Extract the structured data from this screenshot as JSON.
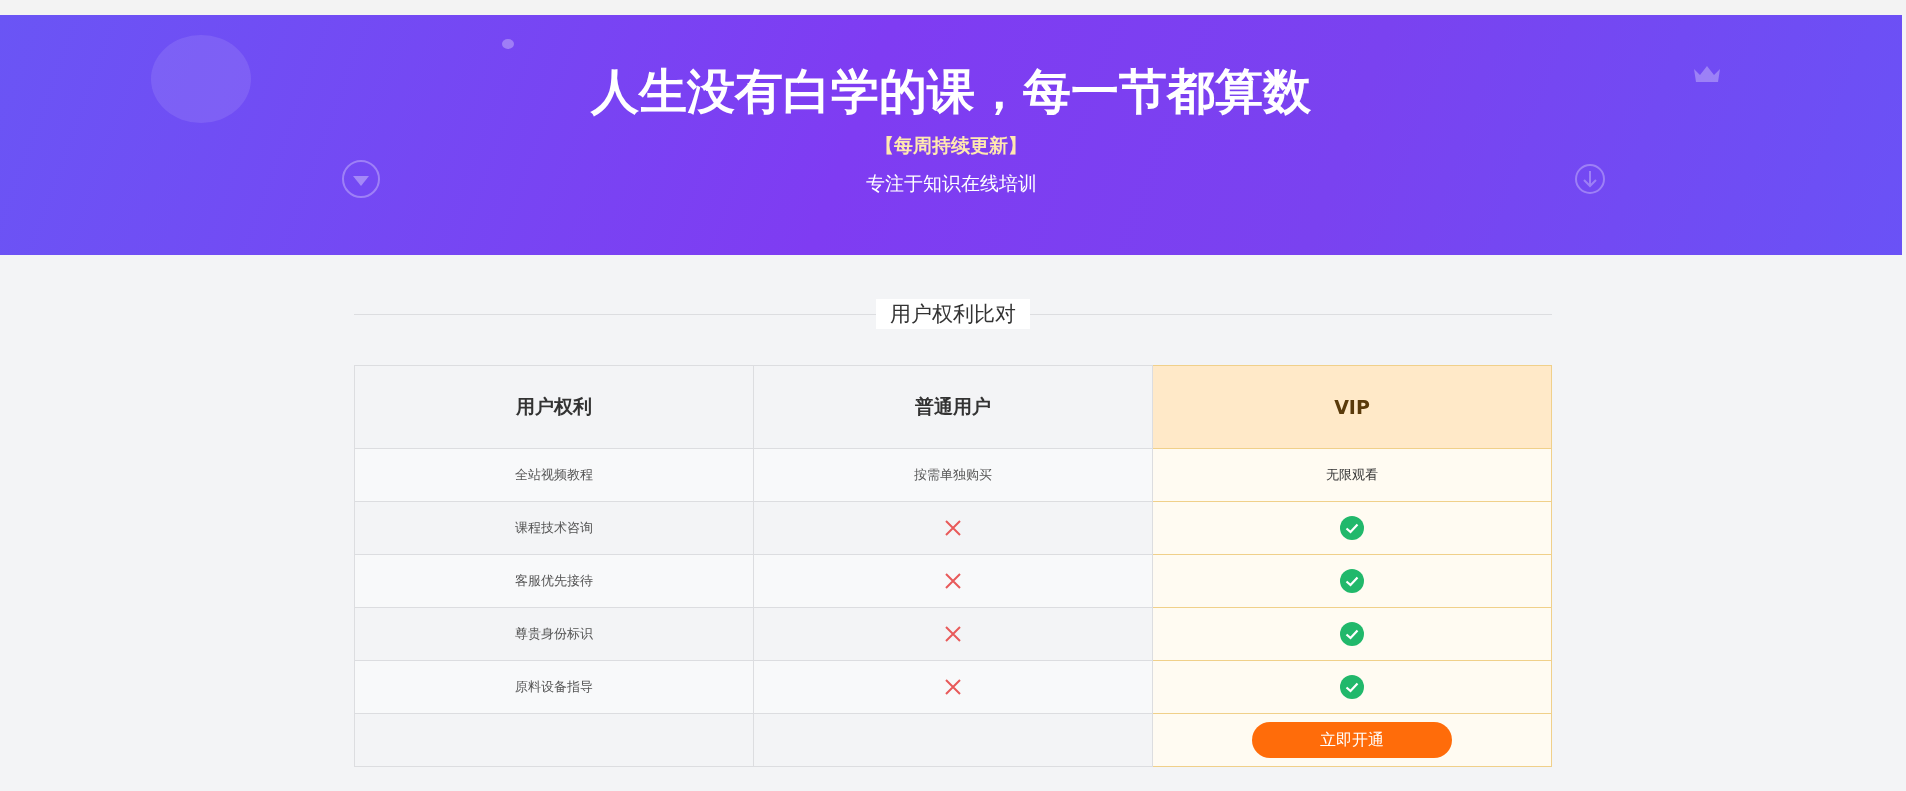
{
  "banner": {
    "title": "人生没有白学的课，每一节都算数",
    "tagline": "【每周持续更新】",
    "subtitle": "专注于知识在线培训"
  },
  "section_title": "用户权利比对",
  "table": {
    "columns": [
      "用户权利",
      "普通用户",
      "VIP"
    ],
    "rows": [
      {
        "feature": "全站视频教程",
        "normal": {
          "kind": "text",
          "text": "按需单独购买"
        },
        "vip": {
          "kind": "text",
          "text": "无限观看"
        }
      },
      {
        "feature": "课程技术咨询",
        "normal": {
          "kind": "cross"
        },
        "vip": {
          "kind": "check"
        }
      },
      {
        "feature": "客服优先接待",
        "normal": {
          "kind": "cross"
        },
        "vip": {
          "kind": "check"
        }
      },
      {
        "feature": "尊贵身份标识",
        "normal": {
          "kind": "cross"
        },
        "vip": {
          "kind": "check"
        }
      },
      {
        "feature": "原料设备指导",
        "normal": {
          "kind": "cross"
        },
        "vip": {
          "kind": "check"
        }
      },
      {
        "normal": {
          "kind": "empty"
        },
        "vip": {
          "kind": "button",
          "text": "立即开通"
        }
      }
    ]
  }
}
